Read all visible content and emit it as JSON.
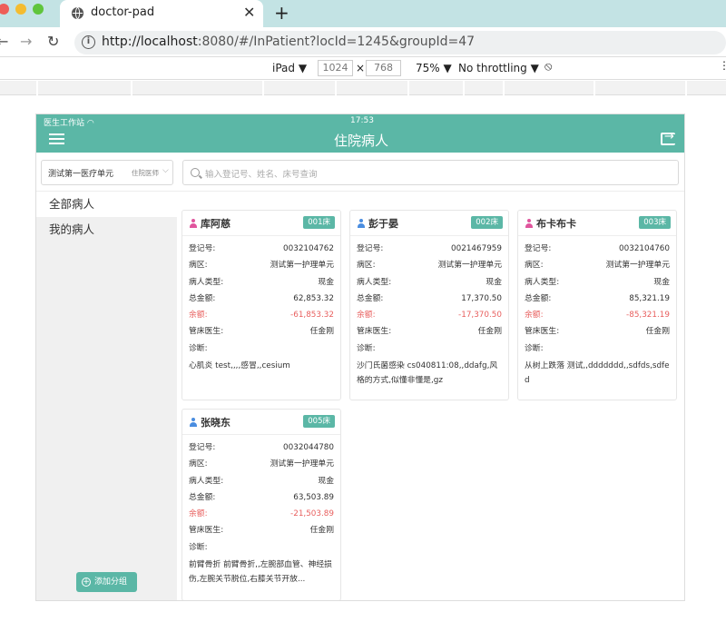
{
  "browser": {
    "tab_title": "doctor-pad",
    "url_host": "http://localhost",
    "url_rest": ":8080/#/InPatient?locId=1245&groupId=47",
    "device": "iPad ▼",
    "width": "1024",
    "height": "768",
    "times": "×",
    "zoom": "75% ▼",
    "throttle": "No throttling ▼"
  },
  "app": {
    "status_left": "医生工作站",
    "status_time": "17:53",
    "title": "住院病人",
    "unit_name": "测试第一医疗单元",
    "unit_role": "住院医师",
    "search_placeholder": "输入登记号、姓名、床号查询",
    "sidebar": [
      "全部病人",
      "我的病人"
    ],
    "add_group": "添加分组",
    "labels": {
      "reg": "登记号:",
      "ward": "病区:",
      "type": "病人类型:",
      "total": "总金额:",
      "balance": "余额:",
      "doctor": "管床医生:",
      "diag": "诊断:"
    },
    "colors": {
      "accent": "#5bb7a6",
      "female": "#e0559d",
      "male": "#4a8de0",
      "negative": "#e8605f"
    }
  },
  "patients": [
    {
      "name": "库阿慈",
      "bed": "001床",
      "gender": "female",
      "reg": "0032104762",
      "ward": "测试第一护理单元",
      "type": "现金",
      "total": "62,853.32",
      "balance": "-61,853.32",
      "doctor": "任金刚",
      "diag": "心肌炎 test,,,,感冒,,cesium"
    },
    {
      "name": "彭于晏",
      "bed": "002床",
      "gender": "male",
      "reg": "0021467959",
      "ward": "测试第一护理单元",
      "type": "现金",
      "total": "17,370.50",
      "balance": "-17,370.50",
      "doctor": "任金刚",
      "diag": "沙门氏菌感染 cs040811:08,,ddafg,风格的方式,似懂非懂是,gz"
    },
    {
      "name": "布卡布卡",
      "bed": "003床",
      "gender": "female",
      "reg": "0032104760",
      "ward": "测试第一护理单元",
      "type": "现金",
      "total": "85,321.19",
      "balance": "-85,321.19",
      "doctor": "任金刚",
      "diag": "从树上跌落 测试,,ddddddd,,sdfds,sdfed"
    },
    {
      "name": "张晓东",
      "bed": "005床",
      "gender": "male",
      "reg": "0032044780",
      "ward": "测试第一护理单元",
      "type": "现金",
      "total": "63,503.89",
      "balance": "-21,503.89",
      "doctor": "任金刚",
      "diag": "前臂骨折 前臂骨折,,左腕部血管、神经损伤,左腕关节脱位,右膝关节开放..."
    }
  ]
}
